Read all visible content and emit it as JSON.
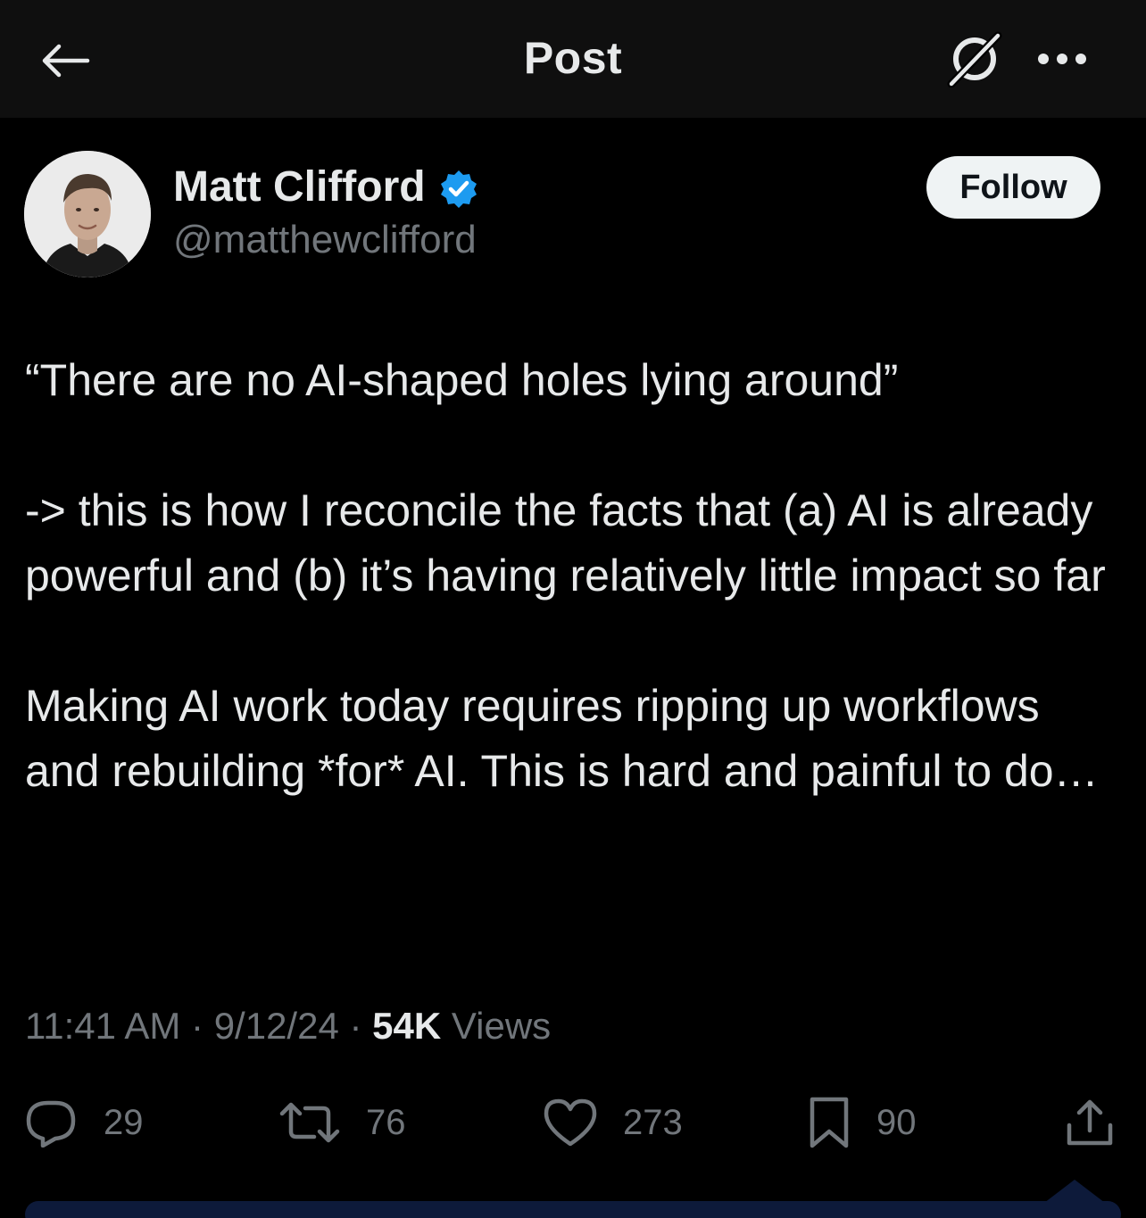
{
  "header": {
    "title": "Post",
    "back_icon": "arrow-left-icon",
    "grok_icon": "grok-icon",
    "more_icon": "more-horizontal-icon"
  },
  "author": {
    "name": "Matt Clifford",
    "handle": "@matthewclifford",
    "verified": true,
    "follow_label": "Follow"
  },
  "post": {
    "paragraphs": [
      "“There are no AI-shaped holes lying around”",
      "-> this is how I reconcile the facts that (a) AI is already powerful and (b) it’s having relatively little impact so far",
      "Making AI work today requires ripping up workflows and rebuilding *for* AI. This is hard and painful to do…"
    ],
    "time": "11:41 AM",
    "date": "9/12/24",
    "views_count": "54K",
    "views_label": "Views",
    "separator": "·"
  },
  "actions": {
    "replies": "29",
    "reposts": "76",
    "likes": "273",
    "bookmarks": "90"
  },
  "colors": {
    "background": "#000000",
    "header_bg": "#0f0f0f",
    "text": "#e7e9ea",
    "muted": "#71767b",
    "verified_blue": "#1d9bf0"
  }
}
